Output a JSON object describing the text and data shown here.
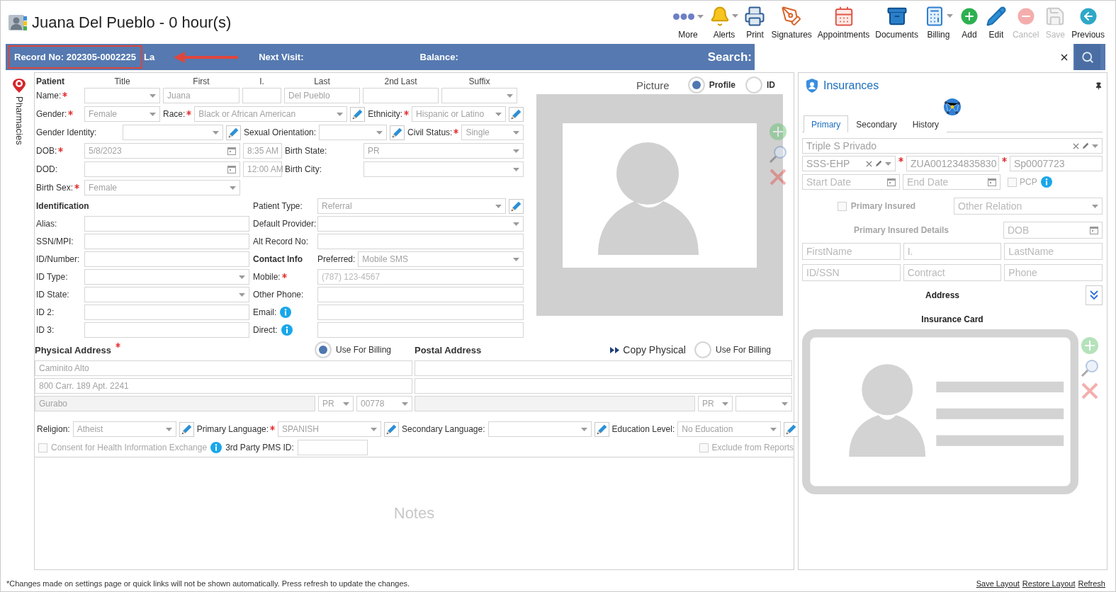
{
  "header": {
    "title": "Juana Del Pueblo - 0 hour(s)"
  },
  "toolbar": [
    {
      "label": "More",
      "dropdown": true,
      "disabled": false
    },
    {
      "label": "Alerts",
      "dropdown": true,
      "disabled": false
    },
    {
      "label": "Print",
      "dropdown": false,
      "disabled": false
    },
    {
      "label": "Signatures",
      "dropdown": false,
      "disabled": false
    },
    {
      "label": "Appointments",
      "dropdown": false,
      "disabled": false
    },
    {
      "label": "Documents",
      "dropdown": false,
      "disabled": false
    },
    {
      "label": "Billing",
      "dropdown": true,
      "disabled": false
    },
    {
      "label": "Add",
      "dropdown": false,
      "disabled": false
    },
    {
      "label": "Edit",
      "dropdown": false,
      "disabled": false
    },
    {
      "label": "Cancel",
      "dropdown": false,
      "disabled": true
    },
    {
      "label": "Save",
      "dropdown": false,
      "disabled": true
    },
    {
      "label": "Previous",
      "dropdown": false,
      "disabled": false
    }
  ],
  "info_bar": {
    "record_no": "Record No: 202305-0002225",
    "highlighted": true,
    "last_visit": "La",
    "next_visit": "Next Visit:",
    "balance": "Balance:",
    "search_label": "Search:"
  },
  "side_tabs": [
    {
      "label": "Pharmacies"
    }
  ],
  "patient": {
    "heading": "Patient",
    "name_columns": [
      "Title",
      "First",
      "I.",
      "Last",
      "2nd Last",
      "Suffix"
    ],
    "name": {
      "label": "Name:",
      "required": true,
      "parts": [
        {
          "kind": "select"
        },
        {
          "kind": "text",
          "value": "Juana"
        },
        {
          "kind": "text"
        },
        {
          "kind": "text",
          "value": "Del Pueblo"
        },
        {
          "kind": "text"
        },
        {
          "kind": "select"
        }
      ]
    },
    "gender": {
      "label": "Gender:",
      "required": true,
      "kind": "select",
      "value": "Female"
    },
    "race": {
      "label": "Race:",
      "required": true,
      "kind": "select",
      "value": "Black or African American",
      "editable": true
    },
    "ethnicity": {
      "label": "Ethnicity:",
      "required": true,
      "kind": "select",
      "value": "Hispanic or Latino",
      "editable": true
    },
    "gender_identity": {
      "label": "Gender Identity:",
      "kind": "select",
      "editable": true
    },
    "sexual_orientation": {
      "label": "Sexual Orientation:",
      "kind": "select",
      "editable": true
    },
    "civil_status": {
      "label": "Civil Status:",
      "required": true,
      "kind": "select",
      "value": "Single"
    },
    "dob": {
      "label": "DOB:",
      "required": true,
      "kind": "date",
      "value": "5/8/2023",
      "time": "8:35 AM"
    },
    "birth_state": {
      "label": "Birth State:",
      "kind": "select",
      "value": "PR"
    },
    "dod": {
      "label": "DOD:",
      "kind": "date",
      "time": "12:00 AM"
    },
    "birth_city": {
      "label": "Birth City:",
      "kind": "select"
    },
    "birth_sex": {
      "label": "Birth Sex:",
      "required": true,
      "kind": "select",
      "value": "Female"
    }
  },
  "identification": {
    "heading": "Identification",
    "fields": [
      {
        "label": "Alias:",
        "kind": "text"
      },
      {
        "label": "SSN/MPI:",
        "kind": "text"
      },
      {
        "label": "ID/Number:",
        "kind": "text"
      },
      {
        "label": "ID Type:",
        "kind": "select"
      },
      {
        "label": "ID State:",
        "kind": "select"
      },
      {
        "label": "ID 2:",
        "kind": "text"
      },
      {
        "label": "ID 3:",
        "kind": "text"
      }
    ]
  },
  "other": {
    "patient_type": {
      "label": "Patient Type:",
      "kind": "select",
      "value": "Referral",
      "editable": true
    },
    "default_provider": {
      "label": "Default Provider:",
      "kind": "select"
    },
    "alt_record": {
      "label": "Alt Record No:",
      "kind": "text"
    }
  },
  "contact": {
    "heading": "Contact Info",
    "preferred": {
      "label": "Preferred:",
      "kind": "select",
      "value": "Mobile SMS"
    },
    "fields": [
      {
        "label": "Mobile:",
        "required": true,
        "kind": "text",
        "placeholder": "(787) 123-4567"
      },
      {
        "label": "Other Phone:",
        "kind": "text"
      },
      {
        "label": "Email:",
        "kind": "text",
        "info": true
      },
      {
        "label": "Direct:",
        "kind": "text",
        "info": true
      }
    ]
  },
  "picture": {
    "label": "Picture",
    "options": [
      {
        "label": "Profile",
        "selected": true
      },
      {
        "label": "ID",
        "selected": false
      }
    ]
  },
  "physical_address": {
    "heading": "Physical Address",
    "required": true,
    "use_for_billing": {
      "label": "Use For Billing",
      "selected": true
    },
    "street": "Caminito Alto",
    "street2": "800 Carr. 189 Apt. 2241",
    "city": "Gurabo",
    "state": "PR",
    "zip": "00778"
  },
  "postal_address": {
    "heading": "Postal Address",
    "copy": "Copy Physical",
    "use_for_billing": {
      "label": "Use For Billing",
      "selected": false
    },
    "state": "PR"
  },
  "demographics": [
    {
      "label": "Religion:",
      "kind": "select",
      "value": "Atheist",
      "editable": true
    },
    {
      "label": "Primary Language:",
      "required": true,
      "kind": "select",
      "value": "SPANISH",
      "editable": true
    },
    {
      "label": "Secondary Language:",
      "kind": "select",
      "editable": true
    },
    {
      "label": "Education Level:",
      "kind": "select",
      "value": "No Education",
      "editable": true
    }
  ],
  "consent": {
    "label": "Consent for Health Information Exchange",
    "checked": false,
    "disabled": true,
    "info": true
  },
  "pms": {
    "label": "3rd Party PMS ID:",
    "kind": "text"
  },
  "exclude": {
    "label": "Exclude from Reports",
    "checked": false,
    "disabled": true
  },
  "notes": {
    "placeholder": "Notes"
  },
  "insurances": {
    "title": "Insurances",
    "tabs": [
      {
        "label": "Primary",
        "selected": true
      },
      {
        "label": "Secondary",
        "selected": false
      },
      {
        "label": "History",
        "selected": false
      }
    ],
    "plan": {
      "kind": "select",
      "value": "Triple S Privado"
    },
    "plan_type": {
      "kind": "select",
      "value": "SSS-EHP"
    },
    "member_id": {
      "kind": "text",
      "value": "ZUA001234835830",
      "required": true
    },
    "group": {
      "kind": "text",
      "value": "Sp0007723",
      "required": true
    },
    "start_date": {
      "kind": "date",
      "placeholder": "Start Date"
    },
    "end_date": {
      "kind": "date",
      "placeholder": "End Date"
    },
    "pcp": {
      "label": "PCP",
      "checked": false,
      "info": true
    },
    "primary_insured": {
      "label": "Primary Insured",
      "checked": false
    },
    "relation": {
      "kind": "select",
      "placeholder": "Other Relation"
    },
    "details_label": "Primary Insured Details",
    "details_dob": {
      "kind": "date",
      "placeholder": "DOB"
    },
    "details": [
      {
        "kind": "text",
        "placeholder": "FirstName"
      },
      {
        "kind": "text",
        "placeholder": "I."
      },
      {
        "kind": "text",
        "placeholder": "LastName"
      },
      {
        "kind": "text",
        "placeholder": "ID/SSN"
      },
      {
        "kind": "text",
        "placeholder": "Contract"
      },
      {
        "kind": "text",
        "placeholder": "Phone"
      }
    ],
    "address_label": "Address",
    "card_label": "Insurance Card"
  },
  "footer": {
    "note": "*Changes made on settings page or quick links will not be shown automatically. Press refresh to update the changes.",
    "links": [
      "Save Layout",
      "Restore Layout",
      "Refresh"
    ]
  }
}
